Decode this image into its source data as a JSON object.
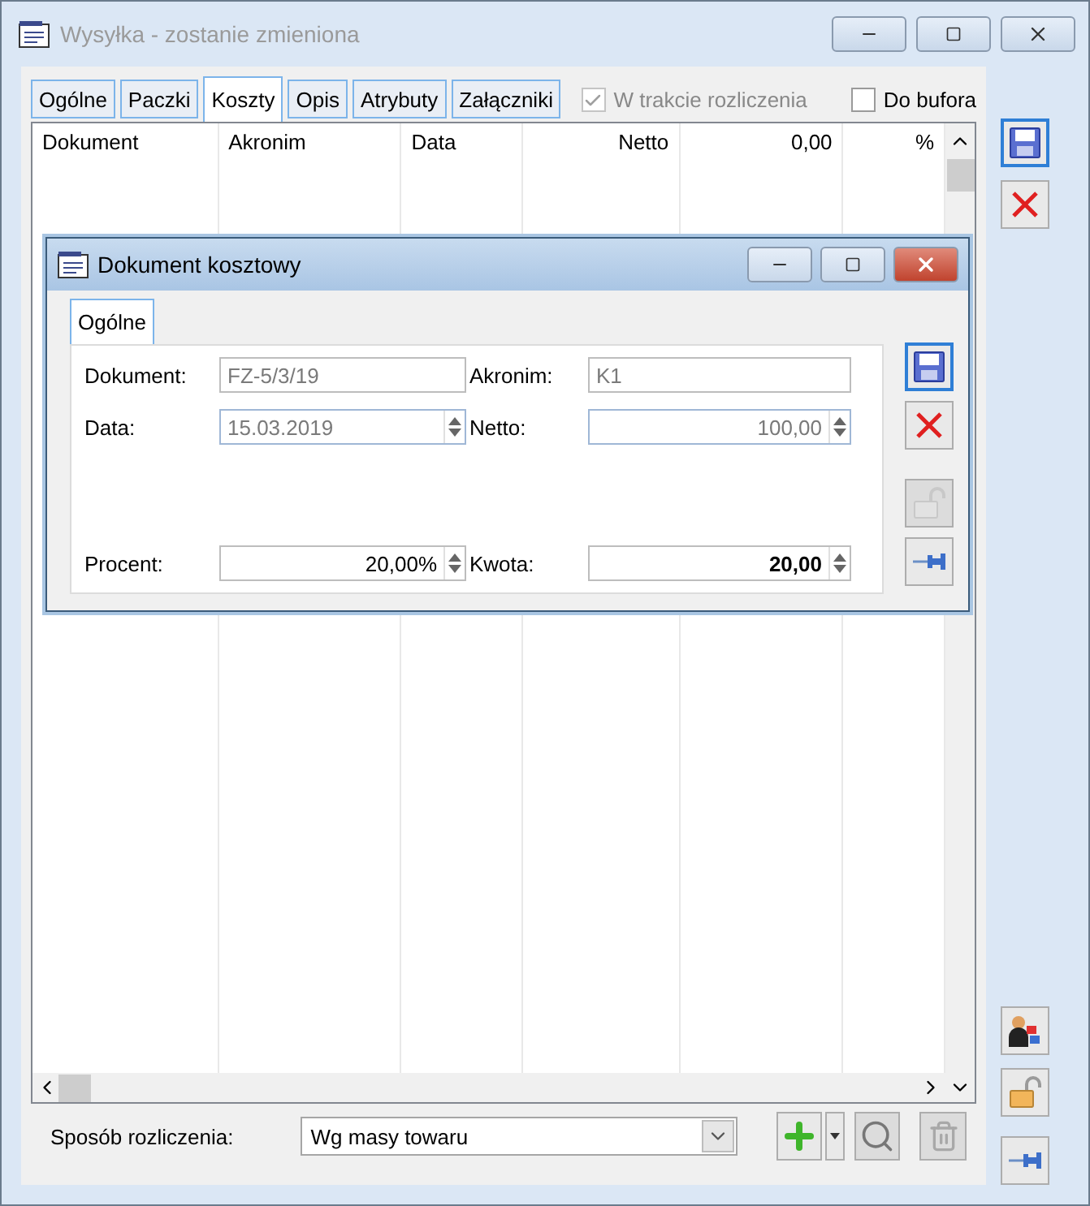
{
  "window": {
    "title": "Wysyłka - zostanie zmieniona"
  },
  "tabs": [
    {
      "label": "Ogólne",
      "selected": false
    },
    {
      "label": "Paczki",
      "selected": false
    },
    {
      "label": "Koszty",
      "selected": true
    },
    {
      "label": "Opis",
      "selected": false
    },
    {
      "label": "Atrybuty",
      "selected": false
    },
    {
      "label": "Załączniki",
      "selected": false
    }
  ],
  "options": [
    {
      "label": "W trakcie rozliczenia",
      "checked": true,
      "disabled": true
    },
    {
      "label": "Do bufora",
      "checked": false,
      "disabled": false
    }
  ],
  "table": {
    "columns": [
      {
        "label": "Dokument"
      },
      {
        "label": "Akronim"
      },
      {
        "label": "Data"
      },
      {
        "label": "Netto"
      },
      {
        "label": "0,00"
      },
      {
        "label": "%"
      }
    ]
  },
  "footer": {
    "label": "Sposób rozliczenia:",
    "value": "Wg masy towaru"
  },
  "dialog": {
    "title": "Dokument kosztowy",
    "tabs": [
      {
        "label": "Ogólne",
        "selected": true
      }
    ],
    "fields": [
      {
        "label": "Dokument:",
        "value": "FZ-5/3/19",
        "kind": "text",
        "disabled": true,
        "bold": false
      },
      {
        "label": "Akronim:",
        "value": "K1",
        "kind": "text",
        "disabled": true,
        "bold": false
      },
      {
        "label": "Data:",
        "value": "15.03.2019",
        "kind": "spin",
        "disabled": true,
        "bold": false
      },
      {
        "label": "Netto:",
        "value": "100,00",
        "kind": "spin",
        "disabled": true,
        "bold": false
      },
      {
        "label": "Procent:",
        "value": "20,00%",
        "kind": "spin",
        "disabled": false,
        "bold": false
      },
      {
        "label": "Kwota:",
        "value": "20,00",
        "kind": "spin",
        "disabled": false,
        "bold": true
      }
    ]
  }
}
